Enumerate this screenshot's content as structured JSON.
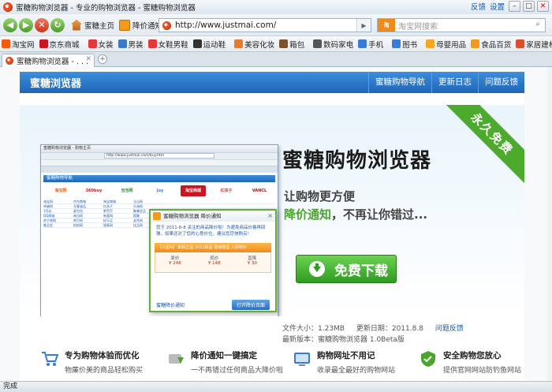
{
  "window": {
    "title": "蜜糖购物浏览器 - 专业的购物浏览器 - 蜜糖购物浏览器",
    "feedback_link": "反馈",
    "settings_link": "设置"
  },
  "toolbar": {
    "home_label": "蜜糖主页",
    "price_alert_label": "降价通知"
  },
  "address_bar": {
    "url": "http://www.justmai.com/"
  },
  "search": {
    "placeholder": "淘宝网搜索",
    "engine_badge": "淘"
  },
  "favorites": [
    {
      "label": "淘宝网",
      "color": "#f25a0c"
    },
    {
      "label": "京东商城",
      "color": "#c81623"
    },
    {
      "label": "女装",
      "color": "#e4393c"
    },
    {
      "label": "男装",
      "color": "#3c78c3"
    },
    {
      "label": "女鞋男鞋",
      "color": "#e4393c"
    },
    {
      "label": "运动鞋",
      "color": "#333333"
    },
    {
      "label": "美容化妆",
      "color": "#e67a2e"
    },
    {
      "label": "箱包",
      "color": "#7a5230"
    },
    {
      "label": "数码家电",
      "color": "#555555"
    },
    {
      "label": "手机",
      "color": "#3a7bd5"
    },
    {
      "label": "图书",
      "color": "#3a7bd5"
    },
    {
      "label": "母婴用品",
      "color": "#f6a623"
    },
    {
      "label": "食品百货",
      "color": "#f29a1d"
    },
    {
      "label": "家居建材",
      "color": "#d9502c"
    }
  ],
  "tab": {
    "label": "蜜糖购物浏览器 - . . ."
  },
  "site": {
    "brand": "蜜糖浏览器",
    "menu": [
      "蜜糖购物导航",
      "更新日志",
      "问题反馈"
    ],
    "ribbon": "永久免费",
    "headline": "蜜糖购物浏览器",
    "tagline1": "让购物更方便",
    "tagline2_highlight": "降价通知",
    "tagline2_rest": "，不再让你错过...",
    "download_label": "免费下载",
    "file_size": "文件大小：1.23MB",
    "update_date": "更新日期：2011.8.8",
    "feedback": "问题反馈",
    "latest_version": "最新版本：蜜糖购物浏览器 1.0Beta版"
  },
  "mini_screenshot": {
    "title": "蜜糖购物浏览器 - 购物主页",
    "url": "http://www.justmai.com/buy.htm",
    "header": "蜜糖购物导航",
    "logos": [
      {
        "label": "淘宝网",
        "bg": "#ffffff",
        "fg": "#f25a0c"
      },
      {
        "label": "360buy",
        "bg": "#ffffff",
        "fg": "#c81623"
      },
      {
        "label": "当当网",
        "bg": "#ffffff",
        "fg": "#2e8b3a"
      },
      {
        "label": "Joy",
        "bg": "#ffffff",
        "fg": "#3a7bd5"
      },
      {
        "label": "淘宝商城",
        "bg": "#c81623",
        "fg": "#ffffff"
      },
      {
        "label": "红孩子",
        "bg": "#ffffff",
        "fg": "#e4393c"
      },
      {
        "label": "VANCL",
        "bg": "#ffffff",
        "fg": "#8b1a1a"
      }
    ],
    "rows": [
      [
        "淘宝网",
        "京东商城",
        "淘宝商城",
        "当当网"
      ],
      [
        "卓越网",
        "凡客诚品",
        "红孩子",
        "乐淘网"
      ],
      [
        "1号店",
        "麦包包",
        "梦芭莎",
        "聚美优品"
      ],
      [
        "QQ商城",
        "易迅网",
        "新蛋网",
        "国美"
      ],
      [
        "苏宁易购",
        "库巴网",
        "好乐买",
        "走秀网"
      ],
      [
        "唯品会",
        "拍拍网",
        "银泰网",
        "佳品网"
      ]
    ]
  },
  "popup": {
    "title": "蜜糖购物浏览器 降价通知",
    "text": "您于 2011-8-8 关注的商品降价啦！为避免商品价格再回弹，如果还对了您的心意价位，建议您尽快购买！",
    "bar_text": "【三星N】 数码正品 2011新品 促销赠品 入情特价…",
    "stats": [
      {
        "label": "原价",
        "value": "¥ 248"
      },
      {
        "label": "现价",
        "value": "¥ 148"
      },
      {
        "label": "直降",
        "value": "¥ 30"
      }
    ],
    "settings_link": "蜜糖降价通知",
    "open_button": "打开降价页面"
  },
  "features": [
    {
      "title": "专为购物体验而优化",
      "desc": "物廉价美的商品轻松购买",
      "icon": "cart-icon",
      "color": "#3a7bd5"
    },
    {
      "title": "降价通知一键搞定",
      "desc": "一不再错过任何商品大降价啦",
      "icon": "price-drop-icon",
      "color": "#4aa52c"
    },
    {
      "title": "购物网址不用记",
      "desc": "收录最全最好的购物网站",
      "icon": "globe-icon",
      "color": "#3a7bd5"
    },
    {
      "title": "安全购物您放心",
      "desc": "提供官网网站防钓鱼网站",
      "icon": "shield-icon",
      "color": "#4aa52c"
    }
  ],
  "status": {
    "text": "完成"
  }
}
